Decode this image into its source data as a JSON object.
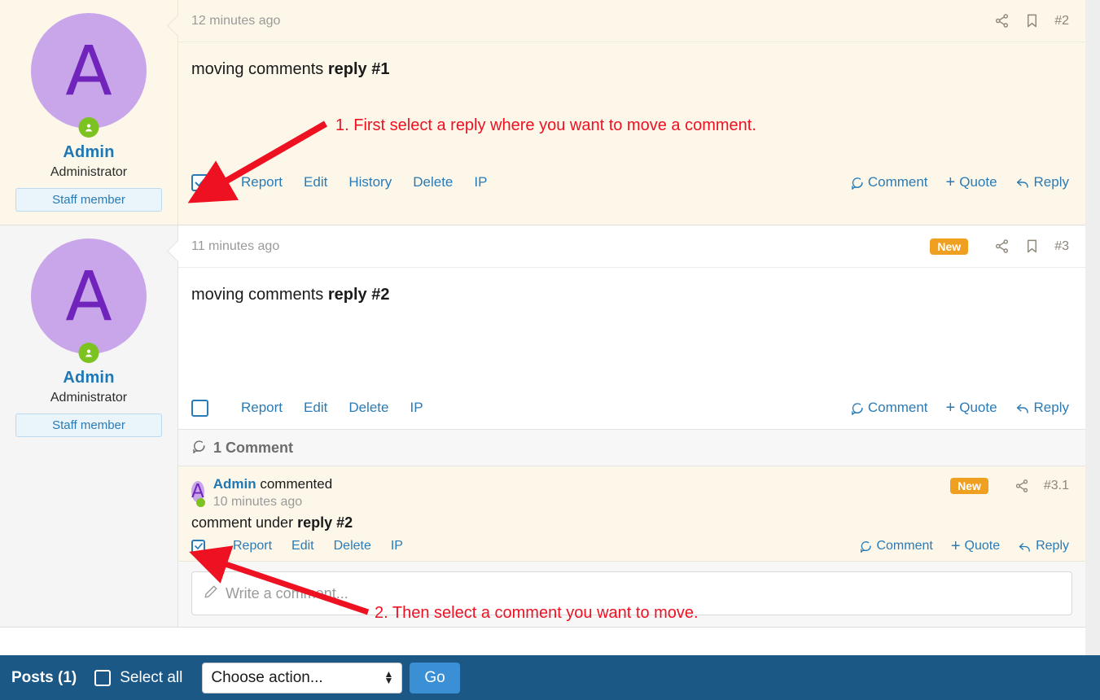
{
  "bottom_bar": {
    "posts_label": "Posts (1)",
    "select_all_label": "Select all",
    "select_all_checked": false,
    "action_select_value": "Choose action...",
    "action_options": [
      "Choose action..."
    ],
    "go_label": "Go",
    "bar_color": "#1b5886",
    "go_color": "#3b8fd4"
  },
  "posts": [
    {
      "number": "#2",
      "time": "12 minutes ago",
      "highlighted": true,
      "new_badge": null,
      "body_plain": "moving comments ",
      "body_bold": "reply #1",
      "checkbox_checked": true,
      "links": [
        "Report",
        "Edit",
        "History",
        "Delete",
        "IP"
      ],
      "actions": [
        "Comment",
        "Quote",
        "Reply"
      ],
      "author": {
        "initial": "A",
        "name": "Admin",
        "title": "Administrator",
        "badge": "Staff member",
        "online": true
      }
    },
    {
      "number": "#3",
      "time": "11 minutes ago",
      "highlighted": false,
      "new_badge": "New",
      "body_plain": "moving comments ",
      "body_bold": "reply #2",
      "checkbox_checked": false,
      "links": [
        "Report",
        "Edit",
        "Delete",
        "IP"
      ],
      "actions": [
        "Comment",
        "Quote",
        "Reply"
      ],
      "author": {
        "initial": "A",
        "name": "Admin",
        "title": "Administrator",
        "badge": "Staff member",
        "online": true
      },
      "comments_section": {
        "header": "1 Comment",
        "comment": {
          "number": "#3.1",
          "new_badge": "New",
          "author_name": "Admin",
          "author_suffix": " commented",
          "initial": "A",
          "time": "10 minutes ago",
          "body_plain": "comment under ",
          "body_bold": "reply #2",
          "checkbox_checked": true,
          "links": [
            "Report",
            "Edit",
            "Delete",
            "IP"
          ],
          "actions": [
            "Comment",
            "Quote",
            "Reply"
          ]
        },
        "compose_placeholder": "Write a comment..."
      }
    }
  ],
  "annotations": [
    {
      "text": "1. First select a reply where you want to move a comment.",
      "color": "#ee1122"
    },
    {
      "text": "2. Then select a comment you want to move.",
      "color": "#ee1122"
    }
  ]
}
